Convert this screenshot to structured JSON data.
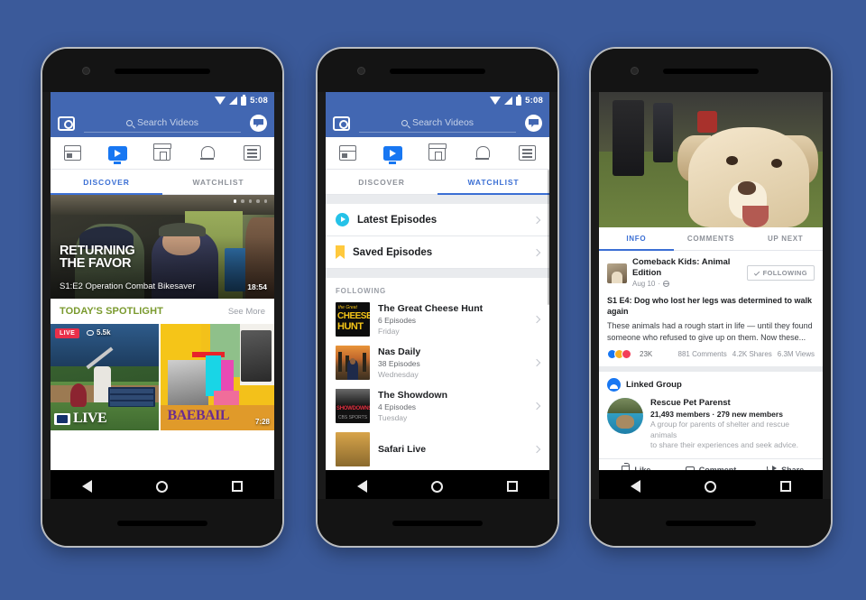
{
  "background_color": "#3b5a9a",
  "accent_blue": "#4267b2",
  "link_blue": "#3b6fd4",
  "spotlight_green": "#7a9a2e",
  "status_bar": {
    "time": "5:08",
    "wifi_icon": "wifi-icon",
    "signal_icon": "signal-icon",
    "battery_icon": "battery-icon"
  },
  "header": {
    "camera_icon": "camera-icon",
    "search_icon": "search-icon",
    "search_placeholder": "Search Videos",
    "messenger_icon": "messenger-icon"
  },
  "icon_tabs": [
    {
      "name": "news-feed",
      "icon": "news-feed-icon",
      "active": false
    },
    {
      "name": "video",
      "icon": "video-icon",
      "active": true
    },
    {
      "name": "marketplace",
      "icon": "marketplace-icon",
      "active": false
    },
    {
      "name": "notifications",
      "icon": "bell-icon",
      "active": false
    },
    {
      "name": "menu",
      "icon": "list-menu-icon",
      "active": false
    }
  ],
  "text_tabs": {
    "discover": "DISCOVER",
    "watchlist": "WATCHLIST"
  },
  "phone1": {
    "active_tab": "DISCOVER",
    "hero": {
      "title_line1": "RETURNING",
      "title_line2": "THE FAVOR",
      "subtitle": "S1:E2 Operation Combat Bikesaver",
      "duration": "18:54",
      "carousel_dots": 5,
      "carousel_active_index": 0
    },
    "spotlight": {
      "heading": "TODAY'S SPOTLIGHT",
      "see_more": "See More",
      "cards": [
        {
          "badge": "LIVE",
          "views": "5.5k",
          "eye_icon": "eye-icon",
          "overlay_text": "LIVE",
          "logo": "mlb-logo"
        },
        {
          "overlay_text": "BAE",
          "overlay_text2": "BAIL",
          "duration": "7:28"
        }
      ]
    }
  },
  "phone2": {
    "active_tab": "WATCHLIST",
    "quick_rows": [
      {
        "label": "Latest Episodes",
        "icon": "play-circle-icon"
      },
      {
        "label": "Saved Episodes",
        "icon": "bookmark-icon"
      }
    ],
    "section_heading": "FOLLOWING",
    "shows": [
      {
        "name": "The Great Cheese Hunt",
        "episodes": "6 Episodes",
        "day": "Friday",
        "thumb": "cheese-hunt-thumb",
        "thumb_text1": "the Great",
        "thumb_text2": "CHEESE",
        "thumb_text3": "HUNT"
      },
      {
        "name": "Nas Daily",
        "episodes": "38 Episodes",
        "day": "Wednesday",
        "thumb": "nas-daily-thumb"
      },
      {
        "name": "The Showdown",
        "episodes": "4 Episodes",
        "day": "Tuesday",
        "thumb": "showdown-thumb",
        "thumb_text1": "SHOWDOWNS",
        "thumb_text2": "CBS SPORTS"
      },
      {
        "name": "Safari Live",
        "episodes": "",
        "day": "",
        "thumb": "safari-live-thumb"
      }
    ]
  },
  "phone3": {
    "video": {
      "poster": "golden-retriever-dog"
    },
    "tabs": [
      {
        "label": "INFO",
        "active": true
      },
      {
        "label": "COMMENTS",
        "active": false
      },
      {
        "label": "UP NEXT",
        "active": false
      }
    ],
    "post": {
      "page_name": "Comeback Kids: Animal Edition",
      "date": "Aug 10",
      "privacy_icon": "globe-icon",
      "follow_button": "FOLLOWING",
      "check_icon": "check-icon",
      "headline": "S1 E4: Dog who lost her legs was determined to walk again",
      "body": "These animals had a rough start in life — until they found someone who refused to give up on them. Now these...",
      "reactions": {
        "icons": [
          "like-icon",
          "wow-icon",
          "love-icon"
        ],
        "count": "23K"
      },
      "comments": "881 Comments",
      "shares": "4.2K Shares",
      "views": "6.3M Views"
    },
    "linked_group": {
      "heading": "Linked Group",
      "icon": "group-icon",
      "name": "Rescue Pet Parenst",
      "members": "21,493 members · 279 new members",
      "description_line1": "A group for parents of shelter and rescue animals",
      "description_line2": "to share their experiences and seek advice."
    },
    "actions": [
      {
        "label": "Like",
        "icon": "thumbs-up-icon"
      },
      {
        "label": "Comment",
        "icon": "comment-icon"
      },
      {
        "label": "Share",
        "icon": "share-icon"
      }
    ]
  },
  "android_nav": {
    "back": "back-icon",
    "home": "home-icon",
    "recents": "recents-icon"
  }
}
